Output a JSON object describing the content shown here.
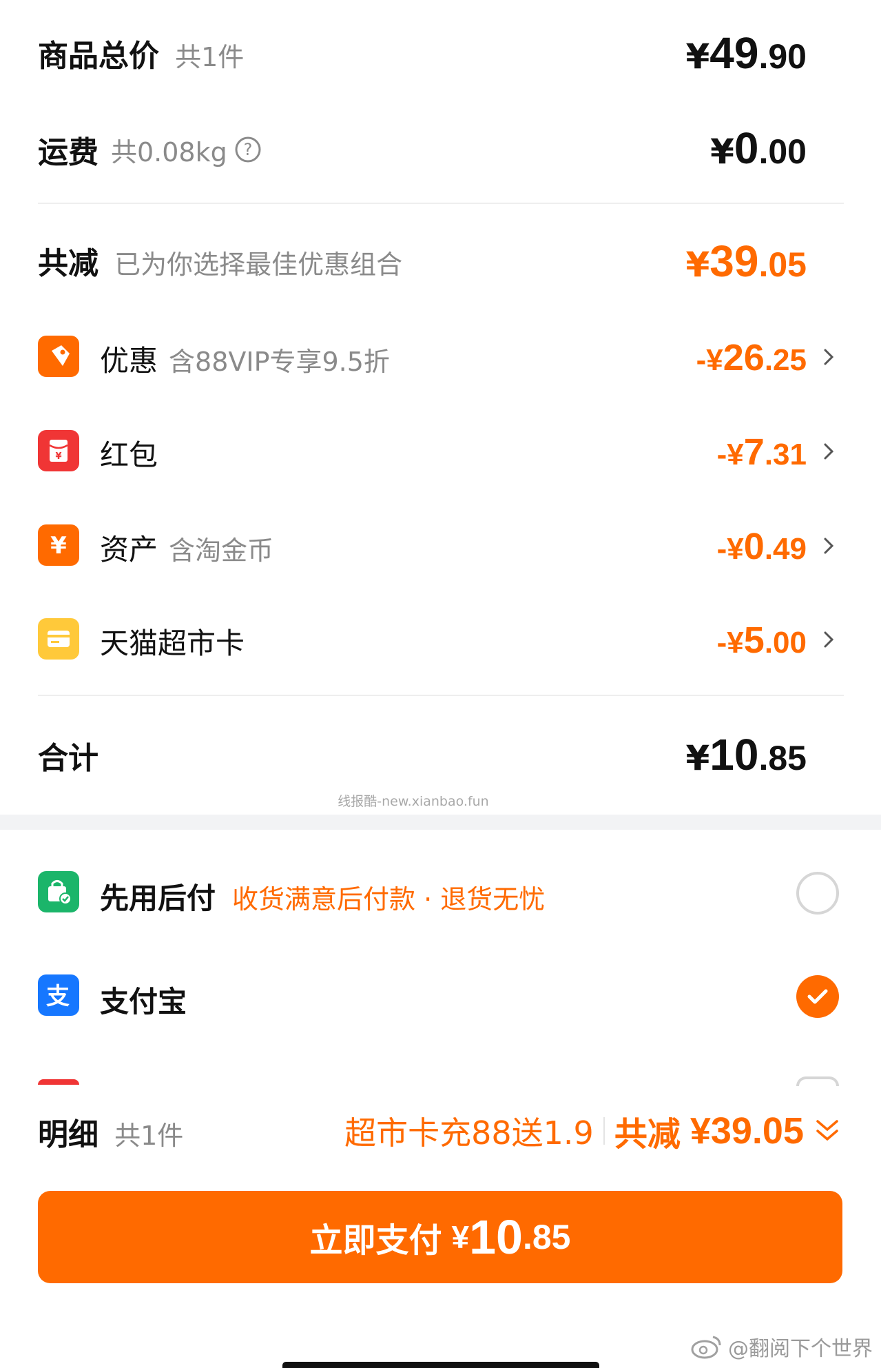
{
  "summary": {
    "goods_total": {
      "label": "商品总价",
      "sub": "共1件",
      "currency": "¥",
      "int": "49",
      "dec": ".90"
    },
    "shipping": {
      "label": "运费",
      "sub": "共0.08kg",
      "help_icon": "question-circle-icon",
      "currency": "¥",
      "int": "0",
      "dec": ".00"
    },
    "total_reduction": {
      "label": "共减",
      "sub": "已为你选择最佳优惠组合",
      "currency": "¥",
      "int": "39",
      "dec": ".05"
    }
  },
  "discounts": [
    {
      "icon": "tag-icon",
      "label": "优惠",
      "sub": "含88VIP专享9.5折",
      "amount_prefix": "-¥",
      "int": "26",
      "dec": ".25",
      "color": "#ff6a00"
    },
    {
      "icon": "red-packet-icon",
      "label": "红包",
      "sub": "",
      "amount_prefix": "-¥",
      "int": "7",
      "dec": ".31",
      "color": "#f03535"
    },
    {
      "icon": "yuan-coin-icon",
      "label": "资产",
      "sub": "含淘金币",
      "amount_prefix": "-¥",
      "int": "0",
      "dec": ".49",
      "color": "#ff6a00"
    },
    {
      "icon": "supermarket-card-icon",
      "label": "天猫超市卡",
      "sub": "",
      "amount_prefix": "-¥",
      "int": "5",
      "dec": ".00",
      "color": "#ffc93a"
    }
  ],
  "grand_total": {
    "label": "合计",
    "currency": "¥",
    "int": "10",
    "dec": ".85"
  },
  "watermark": "线报酷-new.xianbao.fun",
  "payment_methods": [
    {
      "icon": "pay-later-bag-icon",
      "label": "先用后付",
      "sub": "收货满意后付款 · 退货无忧",
      "selected": false,
      "color": "#1bb56a"
    },
    {
      "icon": "alipay-icon",
      "label": "支付宝",
      "sub": "",
      "selected": true,
      "color": "#1677ff"
    }
  ],
  "footer": {
    "detail_label": "明细",
    "detail_sub": "共1件",
    "promo": "超市卡充88送1.9",
    "reduction_label": "共减",
    "reduction_amount": "¥39.05",
    "pay_label": "立即支付",
    "pay_currency": "¥",
    "pay_int": "10",
    "pay_dec": ".85"
  },
  "weibo_watermark": "@翻阅下个世界",
  "colors": {
    "accent": "#ff6a00",
    "text": "#111111",
    "muted": "#8a8a8a"
  }
}
